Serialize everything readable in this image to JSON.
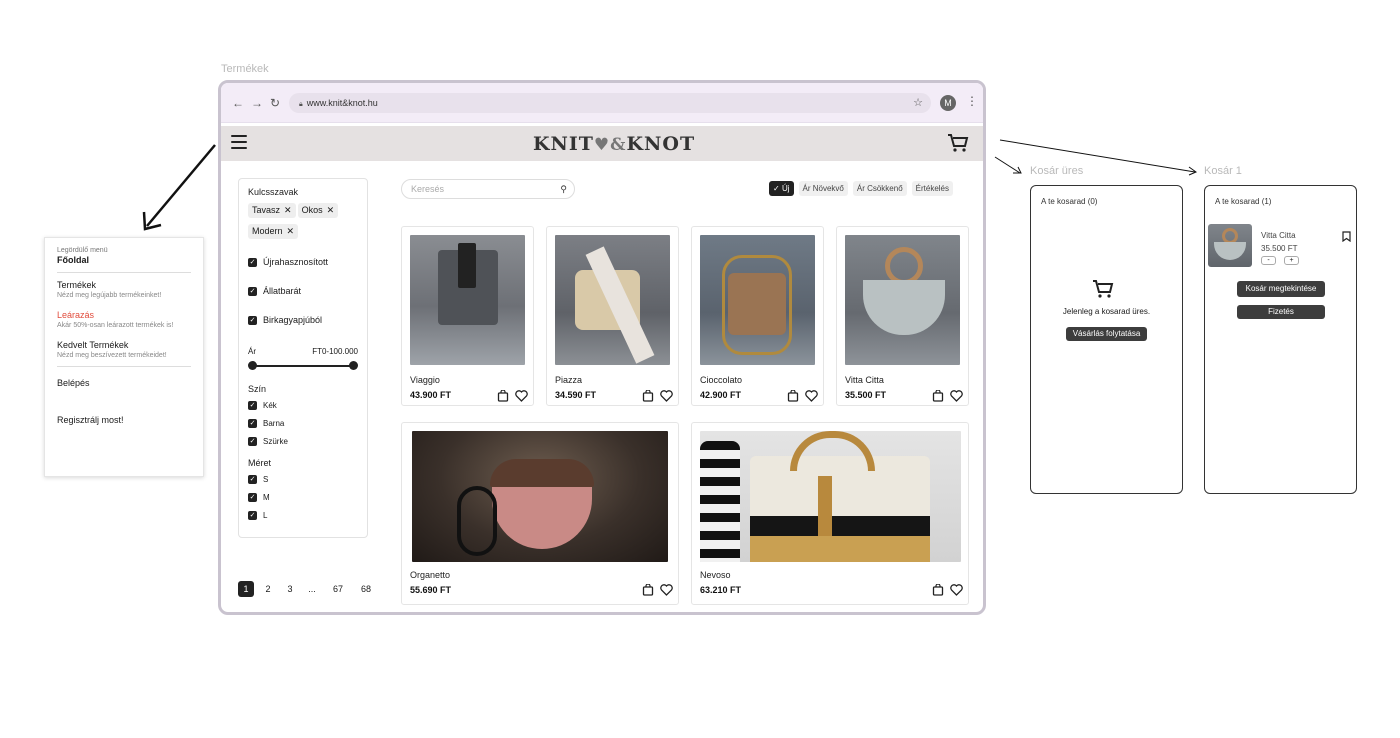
{
  "frames": {
    "products_label": "Termékek",
    "cart_empty_label": "Kosár üres",
    "cart_one_label": "Kosár 1"
  },
  "browser": {
    "url": "www.knit&knot.hu",
    "avatar_letter": "M"
  },
  "site": {
    "logo_left": "KNIT",
    "logo_right": "KNOT"
  },
  "filters": {
    "keywords_heading": "Kulcsszavak",
    "tags": [
      "Tavasz",
      "Okos",
      "Modern"
    ],
    "checks": [
      "Újrahasznosított",
      "Állatbarát",
      "Birkagyapjúból"
    ],
    "price_label": "Ár",
    "price_range": "FT0-100.000",
    "price_min_fraction": 0,
    "price_max_fraction": 1,
    "color_heading": "Szín",
    "colors": [
      "Kék",
      "Barna",
      "Szürke"
    ],
    "size_heading": "Méret",
    "sizes": [
      "S",
      "M",
      "L"
    ]
  },
  "search": {
    "placeholder": "Keresés"
  },
  "sort": {
    "options": [
      "Új",
      "Ár Növekvő",
      "Ár Csökkenő",
      "Értékelés"
    ],
    "active": "Új"
  },
  "products": [
    {
      "name": "Viaggio",
      "price": "43.900 FT"
    },
    {
      "name": "Piazza",
      "price": "34.590 FT"
    },
    {
      "name": "Cioccolato",
      "price": "42.900 FT"
    },
    {
      "name": "Vitta Citta",
      "price": "35.500 FT"
    },
    {
      "name": "Organetto",
      "price": "55.690 FT"
    },
    {
      "name": "Nevoso",
      "price": "63.210 FT"
    }
  ],
  "pagination": {
    "pages": [
      "1",
      "2",
      "3",
      "...",
      "67",
      "68"
    ],
    "current": "1"
  },
  "menu": {
    "caption": "Legördülő menü",
    "title": "Főoldal",
    "items": [
      {
        "title": "Termékek",
        "desc": "Nézd meg legújabb termékeinket!"
      },
      {
        "title": "Leárazás",
        "desc": "Akár 50%-osan leárazott termékek is!"
      },
      {
        "title": "Kedvelt Termékek",
        "desc": "Nézd meg beszívezett termékeidet!"
      }
    ],
    "login": "Belépés",
    "register": "Regisztrálj most!"
  },
  "cart_empty": {
    "title": "A te kosarad (0)",
    "message": "Jelenleg a kosarad üres.",
    "button": "Vásárlás folytatása"
  },
  "cart_one": {
    "title": "A te kosarad (1)",
    "item_name": "Vitta Citta",
    "item_price": "35.500 FT",
    "minus": "-",
    "plus": "+",
    "view_button": "Kosár megtekintése",
    "pay_button": "Fizetés"
  },
  "colors": {
    "accent_dark": "#222222",
    "sale_red": "#e14c3c",
    "header_bg": "#e5e1e1",
    "chrome_bg": "#f3ecf7"
  }
}
